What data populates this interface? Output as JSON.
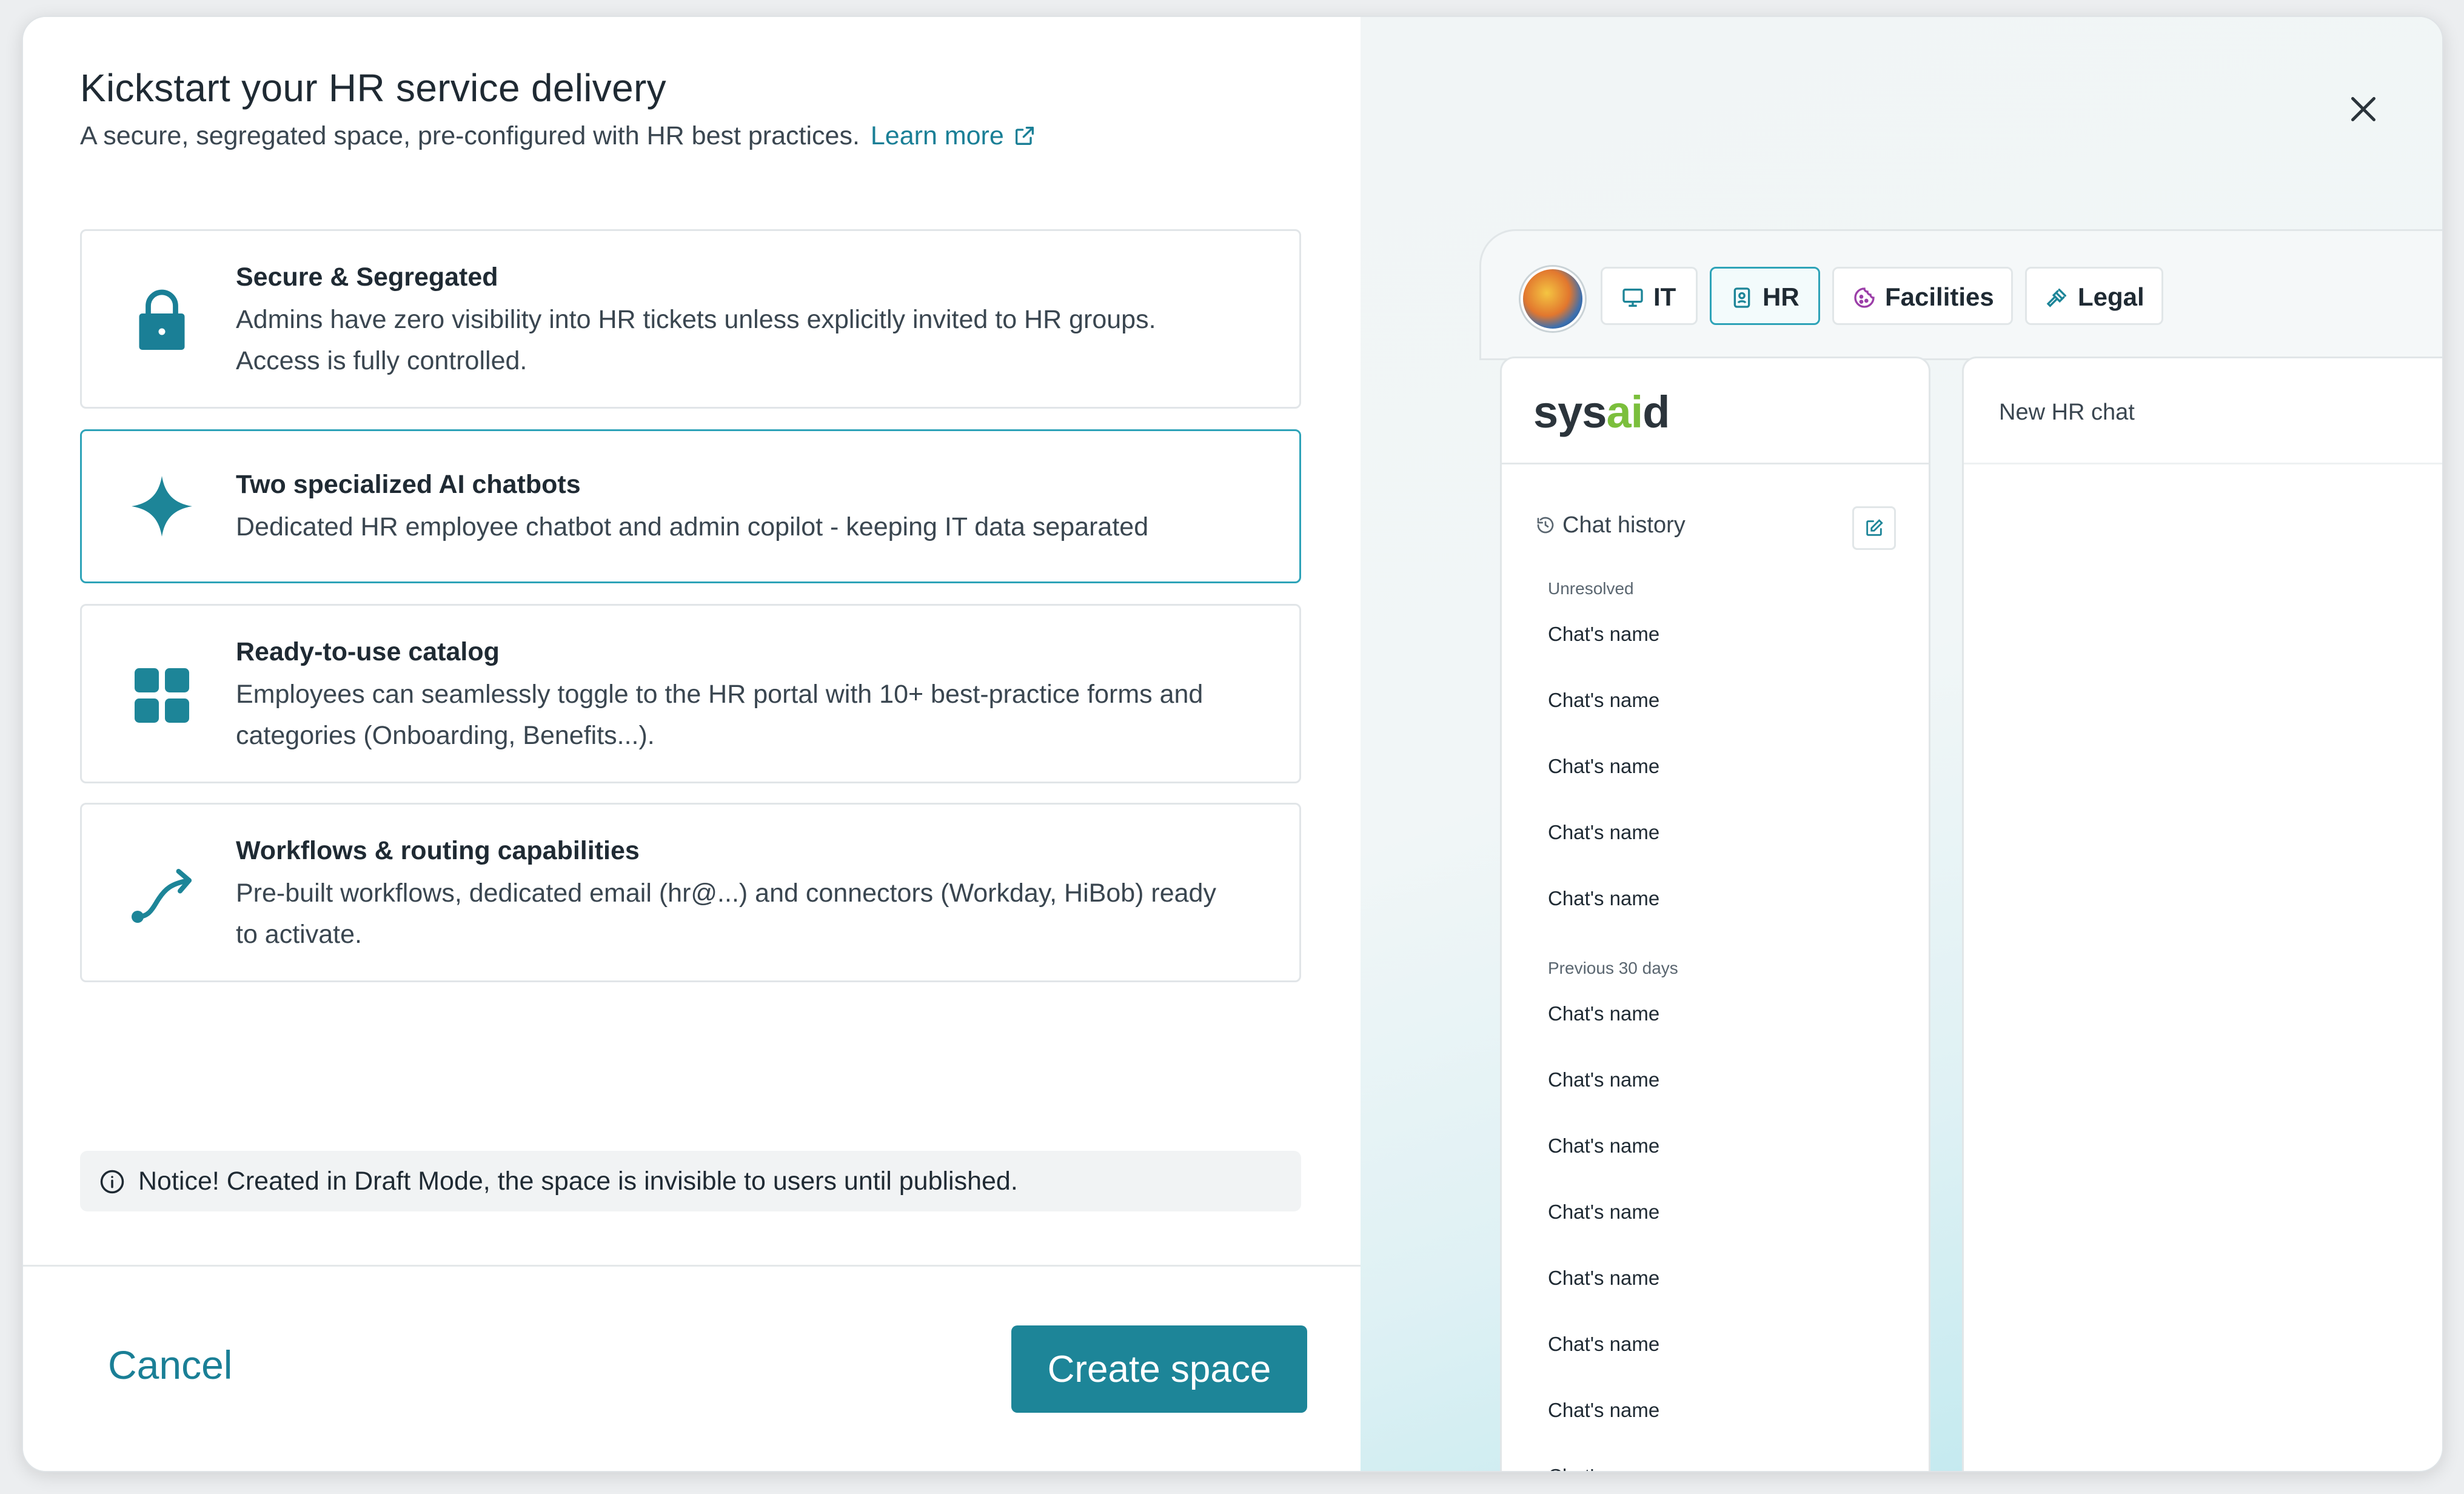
{
  "modal": {
    "title": "Kickstart your HR service delivery",
    "subtitle": "A secure, segregated space, pre-configured with HR best practices.",
    "learn_more": "Learn more",
    "features": [
      {
        "title": "Secure & Segregated",
        "description": "Admins have zero visibility into HR tickets unless explicitly invited to HR groups. Access is fully controlled.",
        "icon": "lock-icon"
      },
      {
        "title": "Two specialized AI chatbots",
        "description": "Dedicated HR employee chatbot and admin copilot - keeping IT data separated",
        "icon": "sparkle-icon"
      },
      {
        "title": "Ready-to-use catalog",
        "description": "Employees can seamlessly toggle to the HR portal with 10+ best-practice forms and categories (Onboarding, Benefits...).",
        "icon": "grid-icon"
      },
      {
        "title": "Workflows & routing capabilities",
        "description": "Pre-built workflows, dedicated email (hr@...) and connectors (Workday, HiBob) ready to activate.",
        "icon": "route-icon"
      }
    ],
    "notice": "Notice! Created in Draft Mode, the space is invisible to users until published.",
    "cancel_label": "Cancel",
    "create_label": "Create space"
  },
  "preview": {
    "tabs": [
      {
        "label": "IT",
        "icon": "monitor-icon"
      },
      {
        "label": "HR",
        "icon": "badge-icon"
      },
      {
        "label": "Facilities",
        "icon": "cookie-icon"
      },
      {
        "label": "Legal",
        "icon": "gavel-icon"
      }
    ],
    "logo_sys": "sys",
    "logo_ai": "ai",
    "logo_d": "d",
    "chat_history_label": "Chat history",
    "groups": {
      "unresolved": "Unresolved",
      "previous": "Previous 30 days"
    },
    "unresolved_chats": [
      "Chat's name",
      "Chat's name",
      "Chat's name",
      "Chat's name",
      "Chat's name"
    ],
    "previous_chats": [
      "Chat's name",
      "Chat's name",
      "Chat's name",
      "Chat's name",
      "Chat's name",
      "Chat's name",
      "Chat's name",
      "Chat's name"
    ],
    "new_chat_label": "New HR chat"
  },
  "colors": {
    "accent": "#1d8598",
    "link": "#1a7f96",
    "active_border": "#2ea3b8"
  }
}
